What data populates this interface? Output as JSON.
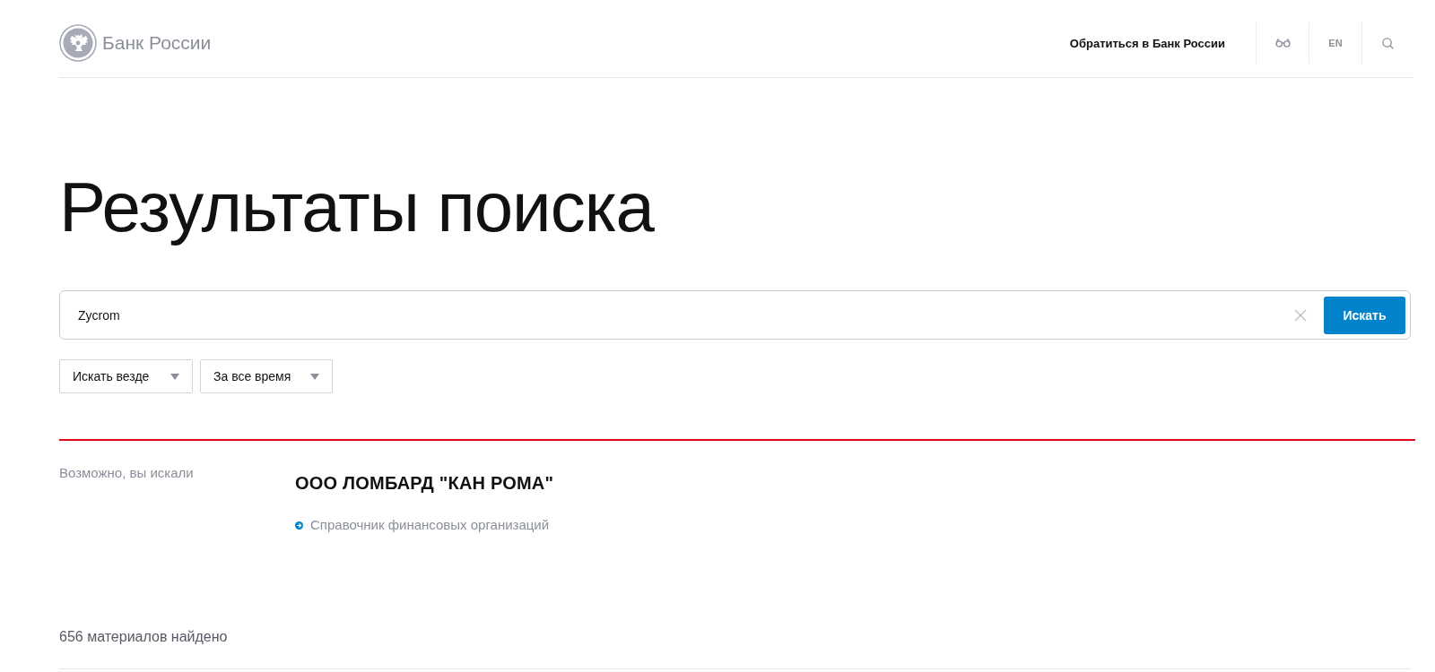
{
  "header": {
    "logo_text": "Банк России",
    "nav_link": "Обратиться в Банк России",
    "language": "EN"
  },
  "page_title": "Результаты поиска",
  "search": {
    "value": "Zycrom",
    "button": "Искать"
  },
  "filters": [
    {
      "label": "Искать везде"
    },
    {
      "label": "За все время"
    }
  ],
  "suggestion": {
    "label": "Возможно, вы искали",
    "title": "ООО ЛОМБАРД \"КАН РОМА\"",
    "link": "Справочник финансовых организаций"
  },
  "results_count": "656 материалов найдено"
}
